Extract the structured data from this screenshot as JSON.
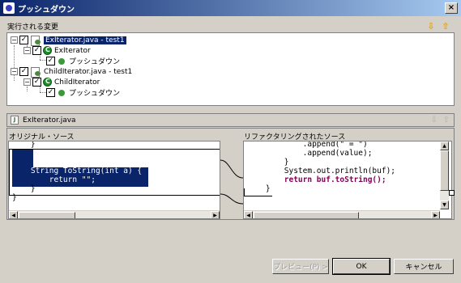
{
  "window": {
    "title": "プッシュダウン",
    "close_label": "×"
  },
  "changes": {
    "section_label": "実行される変更",
    "tree": [
      {
        "label": "ExIterator.java - test1",
        "selected": true
      },
      {
        "label": "ExIterator"
      },
      {
        "label": "プッシュダウン"
      },
      {
        "label": "ChildIterator.java - test1"
      },
      {
        "label": "ChildIterator"
      },
      {
        "label": "プッシュダウン"
      }
    ]
  },
  "preview": {
    "file_label": "ExIterator.java",
    "original_label": "オリジナル・ソース",
    "refactored_label": "リファクタリングされたソース",
    "original_lines": [
      "    }",
      "",
      "",
      "    String ToString(int a) {",
      "        return \"\";",
      "    }",
      "}"
    ],
    "refactored_lines": [
      "            .append(\" = \")",
      "            .append(value);",
      "        }",
      "        System.out.println(buf);",
      "        return buf.toString();",
      "    }",
      "}"
    ]
  },
  "buttons": {
    "preview": "プレビュー(P) >",
    "ok": "OK",
    "cancel": "キャンセル"
  },
  "colors": {
    "selection": "#0a246a",
    "dialog_bg": "#d4d0c8",
    "nav_arrow": "#e8a000"
  }
}
